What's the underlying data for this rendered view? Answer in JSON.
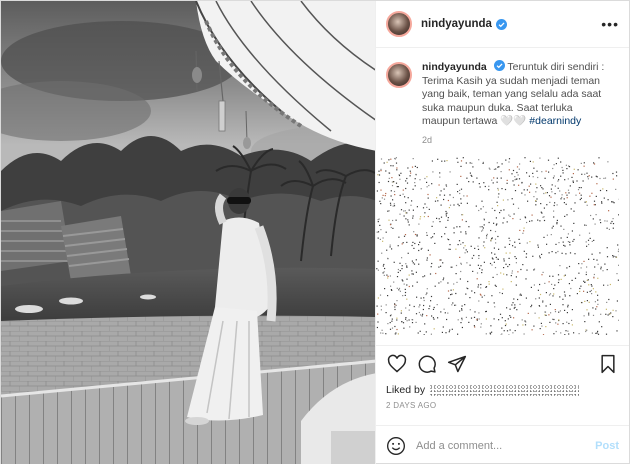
{
  "post": {
    "username": "nindyayunda",
    "verified": true,
    "more_label": "•••",
    "caption_lines": [
      "Teruntuk diri sendiri :",
      "Terima Kasih ya sudah menjadi teman",
      "yang baik, teman yang selalu ada saat",
      "suka maupun duka. Saat terluka",
      "maupun tertawa"
    ],
    "caption_emoji": "🤍🤍",
    "hashtag": "#dearnindy",
    "time_ago": "2d",
    "liked_by_label": "Liked by",
    "date_label": "2 DAYS AGO",
    "comment_placeholder": "Add a comment...",
    "post_label": "Post"
  },
  "colors": {
    "verified": "#3897f0",
    "hashtag": "#00376b",
    "post_button": "#b2dffc",
    "meta_text": "#8e8e8e"
  },
  "icons": {
    "like": "heart-icon",
    "comment": "comment-icon",
    "share": "share-icon",
    "save": "bookmark-icon",
    "emoji": "smiley-icon",
    "more": "ellipsis-icon"
  }
}
